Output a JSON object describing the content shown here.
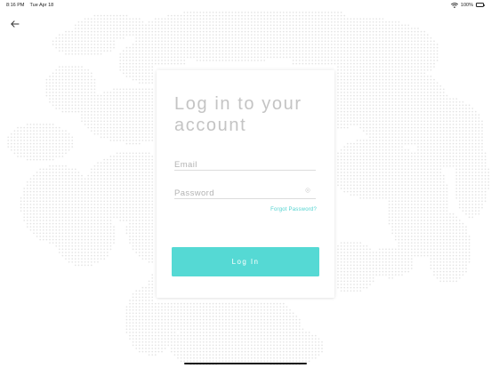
{
  "status_bar": {
    "time": "8:16 PM",
    "date": "Tue Apr 18",
    "battery": "100%",
    "icons": [
      "wifi-icon",
      "battery-icon"
    ]
  },
  "nav": {
    "back_icon": "arrow-left-icon"
  },
  "login": {
    "title": "Log in to your account",
    "email_placeholder": "Email",
    "email_value": "",
    "password_placeholder": "Password",
    "password_value": "",
    "password_icon": "eye-icon",
    "forgot_label": "Forgot Password?",
    "button_label": "Log In"
  },
  "colors": {
    "accent": "#55d9d4",
    "link": "#4fd2cf",
    "title": "#c4c4c4",
    "map_dots": "#e4e4e4"
  }
}
